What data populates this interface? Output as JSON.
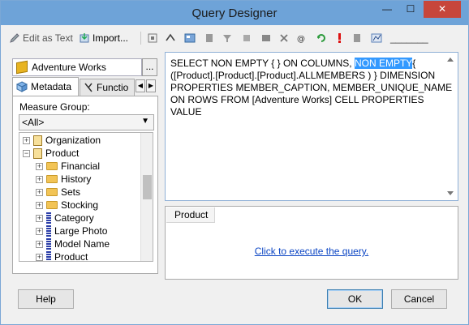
{
  "window": {
    "title": "Query Designer",
    "minimize": "—",
    "maximize": "☐",
    "close": "✕"
  },
  "toolbar": {
    "edit_as_text": "Edit as Text",
    "import": "Import...",
    "blank_field": "_______"
  },
  "cube": {
    "name": "Adventure Works",
    "browse": "..."
  },
  "tabs": {
    "metadata": "Metadata",
    "functions": "Functio"
  },
  "measure_group": {
    "label": "Measure Group:",
    "value": "<All>"
  },
  "tree": [
    {
      "label": "Organization",
      "type": "dimension",
      "expanded": false
    },
    {
      "label": "Product",
      "type": "dimension",
      "expanded": true
    },
    {
      "label": "Financial",
      "type": "folder"
    },
    {
      "label": "History",
      "type": "folder"
    },
    {
      "label": "Sets",
      "type": "folder"
    },
    {
      "label": "Stocking",
      "type": "folder"
    },
    {
      "label": "Category",
      "type": "hierarchy"
    },
    {
      "label": "Large Photo",
      "type": "hierarchy"
    },
    {
      "label": "Model Name",
      "type": "hierarchy"
    },
    {
      "label": "Product",
      "type": "hierarchy"
    }
  ],
  "query": {
    "before": " SELECT NON EMPTY { } ON COLUMNS, ",
    "selected": "NON EMPTY",
    "after": "{ ([Product].[Product].[Product].ALLMEMBERS ) } DIMENSION PROPERTIES MEMBER_CAPTION, MEMBER_UNIQUE_NAME ON ROWS FROM [Adventure Works] CELL PROPERTIES VALUE"
  },
  "results": {
    "column_header": "Product",
    "execute_link": "Click to execute the query."
  },
  "buttons": {
    "help": "Help",
    "ok": "OK",
    "cancel": "Cancel"
  }
}
